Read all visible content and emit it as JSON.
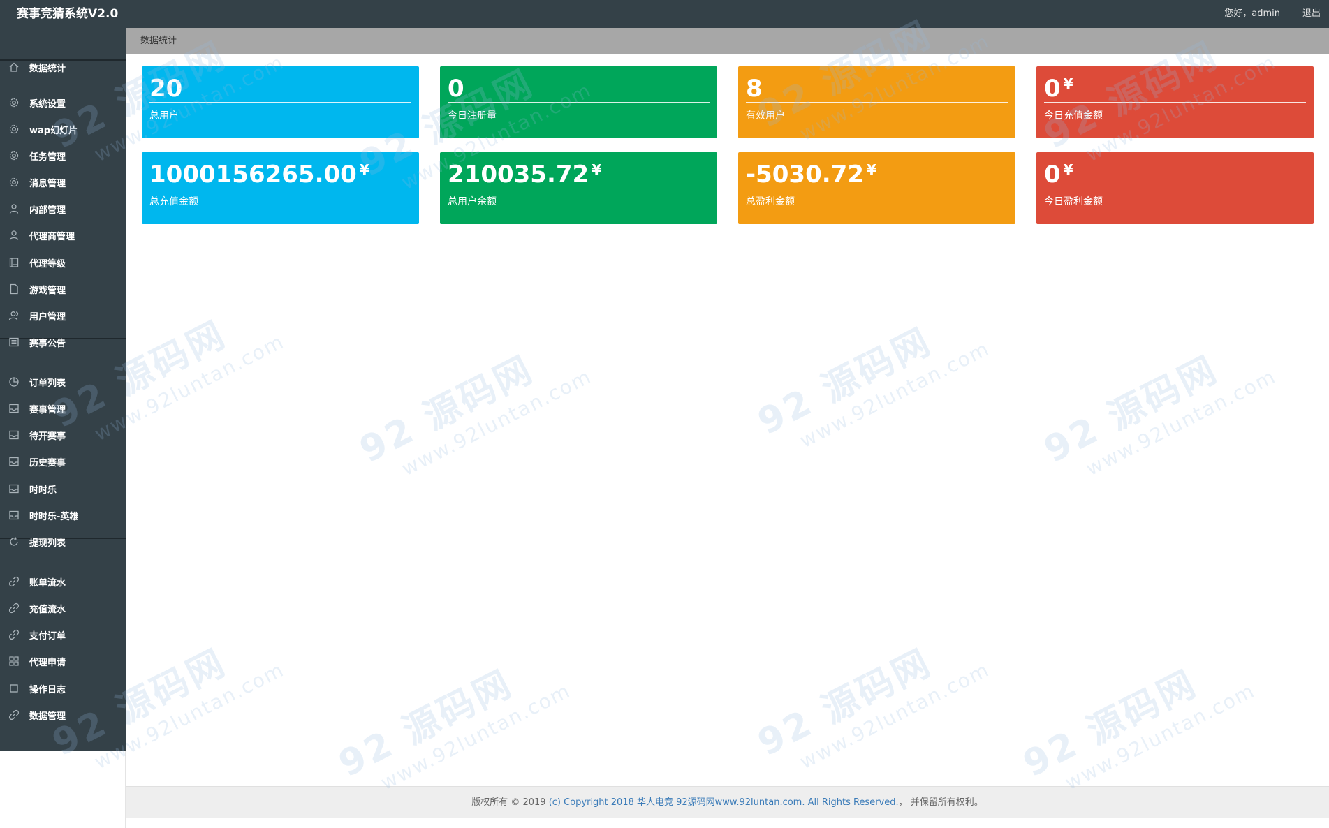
{
  "app": {
    "title": "赛事竞猜系统V2.0",
    "greeting": "您好，admin",
    "logout_label": "退出"
  },
  "sidebar": {
    "items": [
      {
        "label": "数据统计",
        "icon": "home-icon"
      },
      {
        "label": "系统设置",
        "icon": "gear-icon"
      },
      {
        "label": "wap幻灯片",
        "icon": "gear-icon"
      },
      {
        "label": "任务管理",
        "icon": "gear-icon"
      },
      {
        "label": "消息管理",
        "icon": "gear-icon"
      },
      {
        "label": "内部管理",
        "icon": "user-icon"
      },
      {
        "label": "代理商管理",
        "icon": "user-icon"
      },
      {
        "label": "代理等级",
        "icon": "book-icon"
      },
      {
        "label": "游戏管理",
        "icon": "file-icon"
      },
      {
        "label": "用户管理",
        "icon": "users-icon"
      },
      {
        "label": "赛事公告",
        "icon": "newspaper-icon"
      },
      {
        "label": "订单列表",
        "icon": "pie-icon"
      },
      {
        "label": "赛事管理",
        "icon": "inbox-icon"
      },
      {
        "label": "待开赛事",
        "icon": "inbox-icon"
      },
      {
        "label": "历史赛事",
        "icon": "inbox-icon"
      },
      {
        "label": "时时乐",
        "icon": "inbox-icon"
      },
      {
        "label": "时时乐-英雄",
        "icon": "inbox-icon"
      },
      {
        "label": "提现列表",
        "icon": "refresh-icon"
      },
      {
        "label": "账单流水",
        "icon": "link-icon"
      },
      {
        "label": "充值流水",
        "icon": "link-icon"
      },
      {
        "label": "支付订单",
        "icon": "link-icon"
      },
      {
        "label": "代理申请",
        "icon": "grid-icon"
      },
      {
        "label": "操作日志",
        "icon": "square-icon"
      },
      {
        "label": "数据管理",
        "icon": "link-icon"
      }
    ]
  },
  "breadcrumb": "数据统计",
  "stats": [
    {
      "value": "20",
      "currency": "",
      "label": "总用户",
      "color": "#00b7ee"
    },
    {
      "value": "0",
      "currency": "",
      "label": "今日注册量",
      "color": "#00a65a"
    },
    {
      "value": "8",
      "currency": "",
      "label": "有效用户",
      "color": "#f39c12"
    },
    {
      "value": "0",
      "currency": "¥",
      "label": "今日充值金额",
      "color": "#dd4b39"
    },
    {
      "value": "1000156265.00",
      "currency": "¥",
      "label": "总充值金额",
      "color": "#00b7ee"
    },
    {
      "value": "210035.72",
      "currency": "¥",
      "label": "总用户余额",
      "color": "#00a65a"
    },
    {
      "value": "-5030.72",
      "currency": "¥",
      "label": "总盈利金额",
      "color": "#f39c12"
    },
    {
      "value": "0",
      "currency": "¥",
      "label": "今日盈利金额",
      "color": "#dd4b39"
    }
  ],
  "footer": {
    "prefix": "版权所有 © 2019 ",
    "link_text": "(c) Copyright 2018 华人电竞 92源码网www.92luntan.com. All Rights Reserved.",
    "suffix": "， 并保留所有权利。"
  },
  "watermark": {
    "big": "92 源码网",
    "small": "www.92luntan.com"
  }
}
